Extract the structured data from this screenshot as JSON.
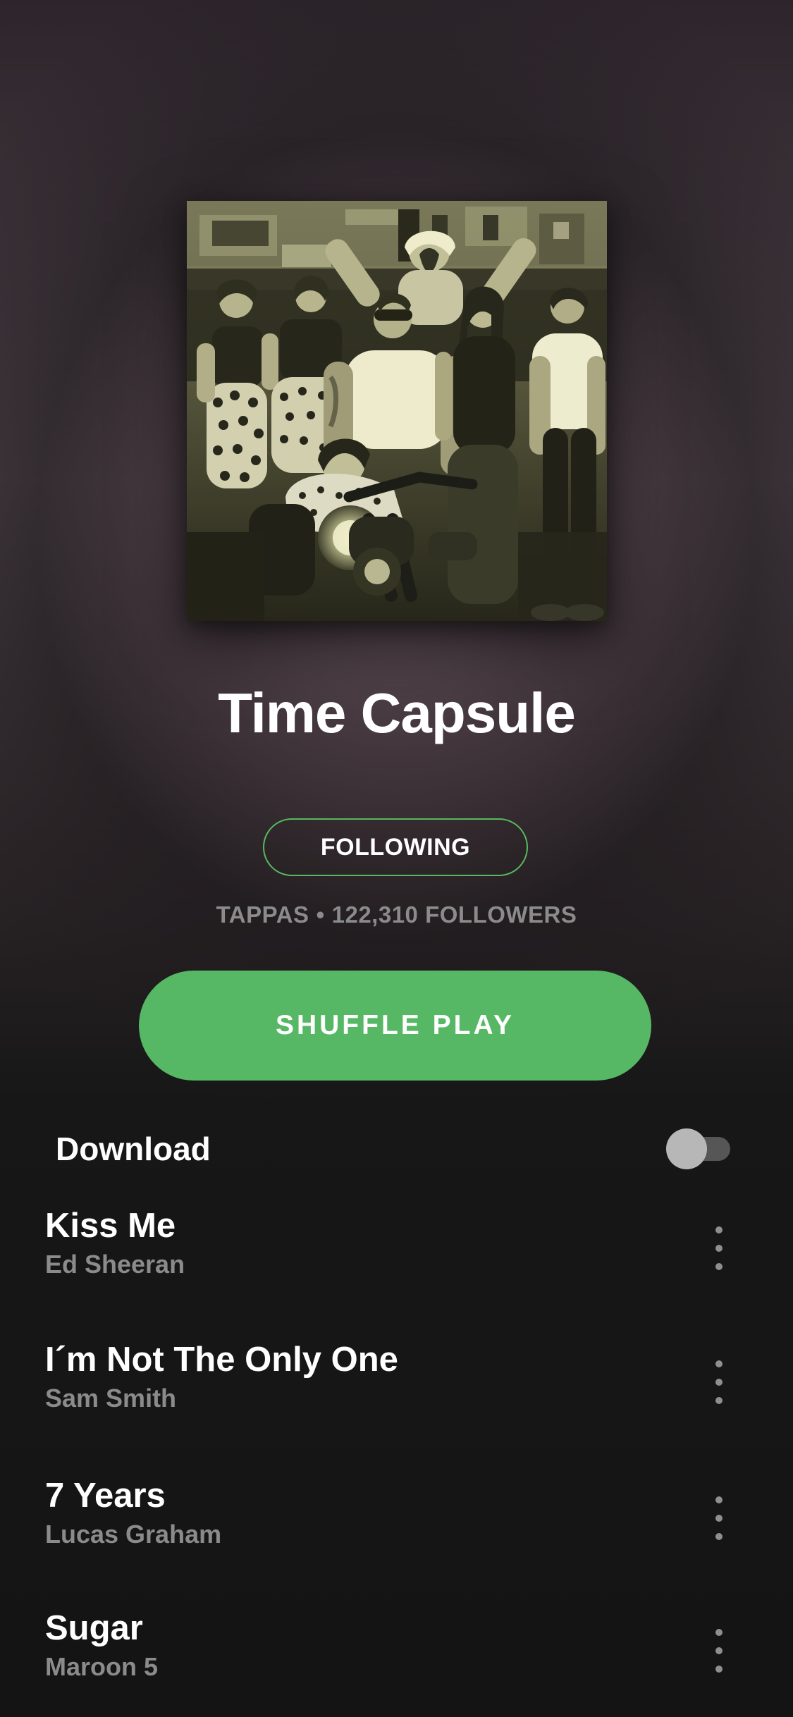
{
  "playlist": {
    "title": "Time Capsule",
    "follow_state": "FOLLOWING",
    "owner": "TAPPAS",
    "separator": "•",
    "followers": "122,310 FOLLOWERS",
    "shuffle_label": "SHUFFLE PLAY"
  },
  "download": {
    "label": "Download",
    "enabled": false
  },
  "tracks": [
    {
      "title": "Kiss Me",
      "artist": "Ed Sheeran"
    },
    {
      "title": "I´m Not The Only One",
      "artist": "Sam Smith"
    },
    {
      "title": "7 Years",
      "artist": "Lucas Graham"
    },
    {
      "title": "Sugar",
      "artist": "Maroon 5"
    }
  ],
  "colors": {
    "accent": "#56b864",
    "background": "#141414",
    "secondary_text": "#8b8b8b"
  },
  "icons": {
    "track_menu": "more-vertical-icon",
    "download_switch": "toggle-off"
  }
}
